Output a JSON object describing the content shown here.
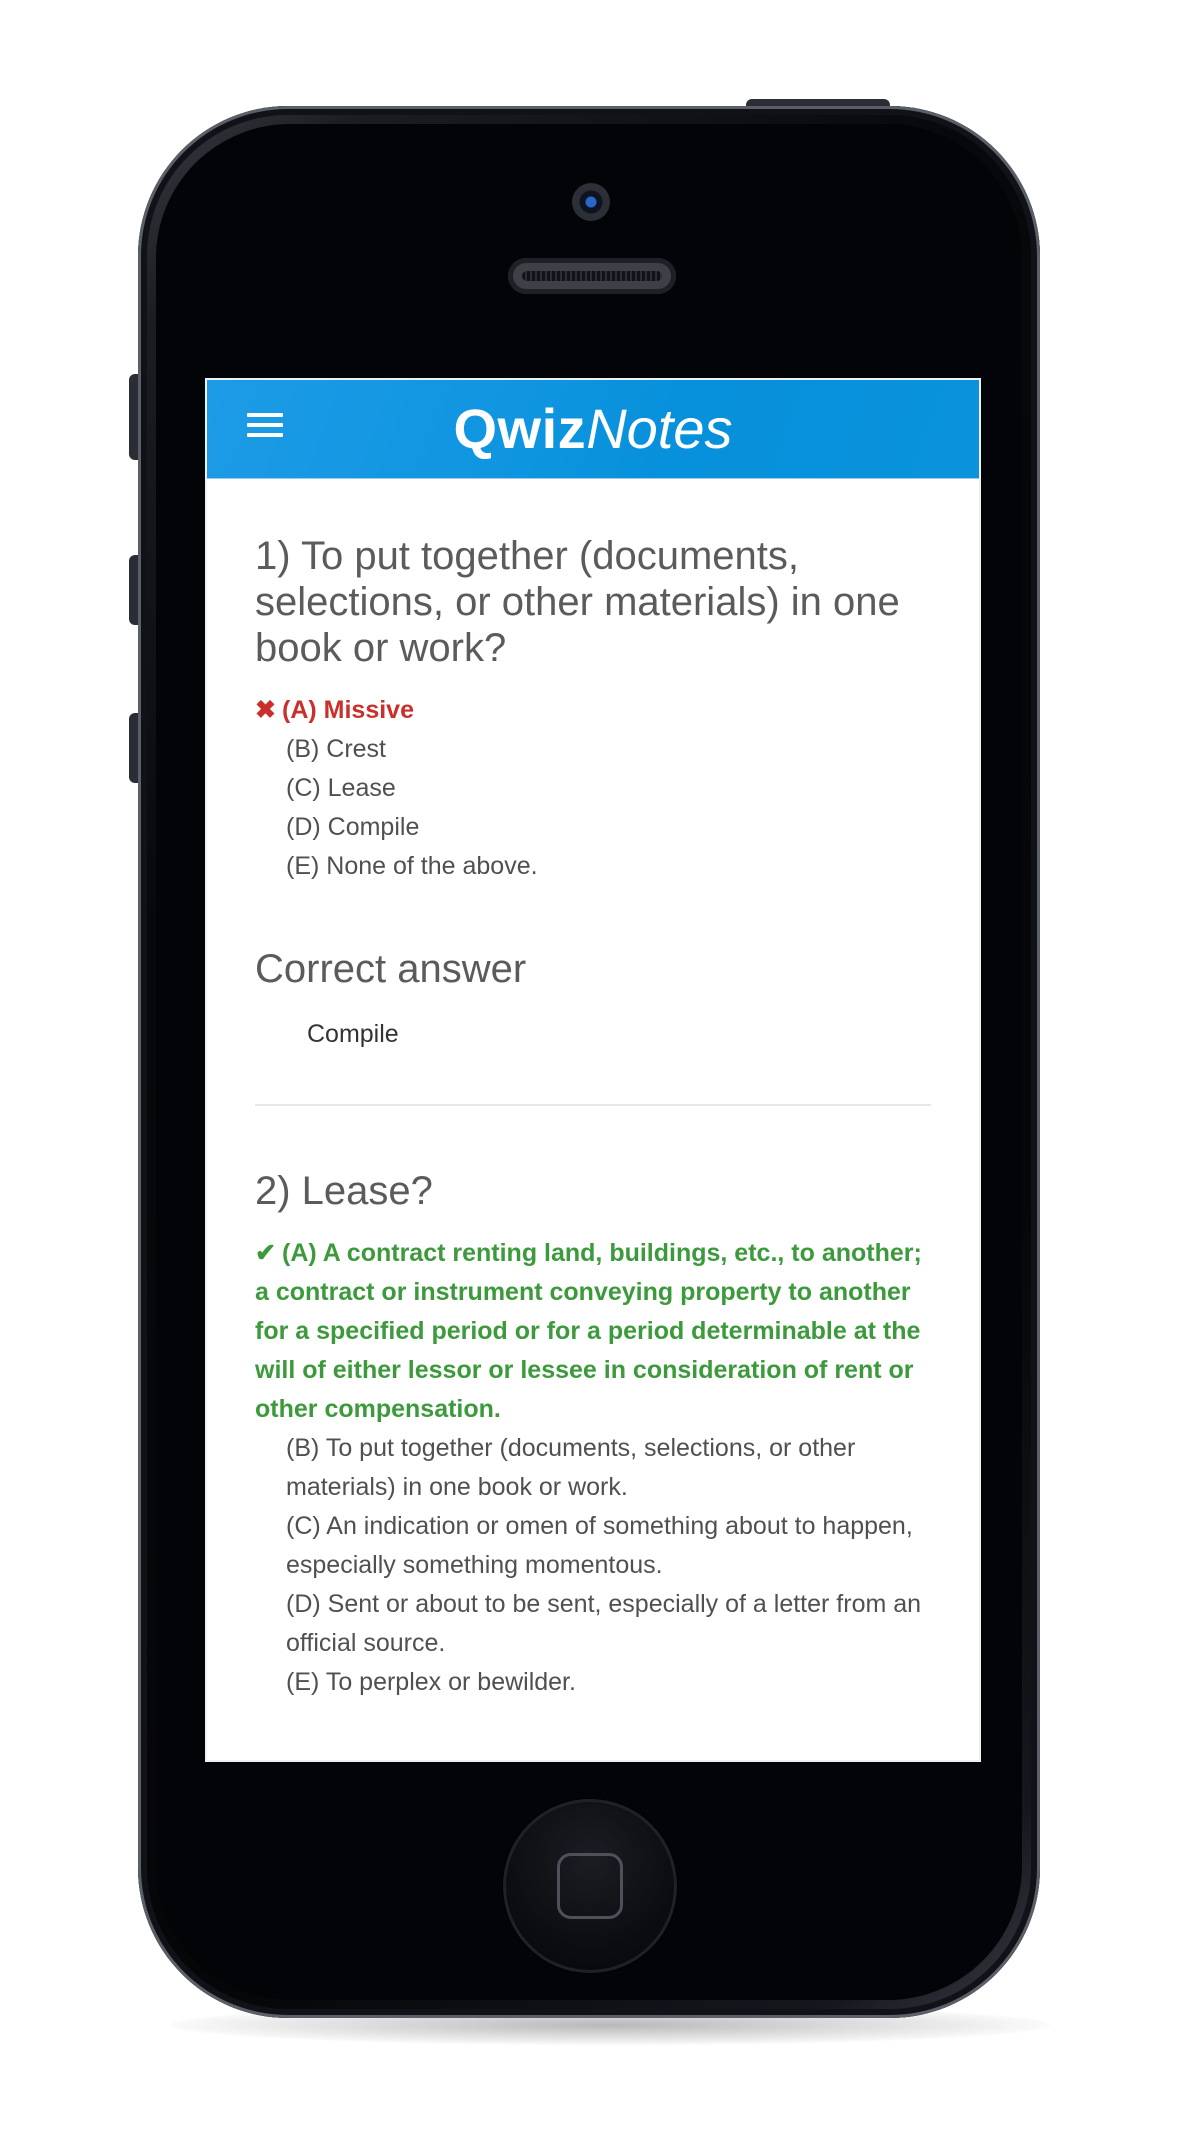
{
  "app": {
    "logo_strong": "Qwiz",
    "logo_light": "Notes"
  },
  "questions": [
    {
      "title": "1) To put together (documents, selections, or other materials) in one book or work?",
      "selected": {
        "mark": "✖",
        "text": "(A) Missive",
        "status": "wrong"
      },
      "options": [
        "(B) Crest",
        "(C) Lease",
        "(D) Compile",
        "(E) None of the above."
      ],
      "correct_heading": "Correct answer",
      "correct_value": "Compile"
    },
    {
      "title": "2) Lease?",
      "selected": {
        "mark": "✔",
        "text": "(A) A contract renting land, buildings, etc., to another; a contract or instrument conveying property to another for a specified period or for a period determinable at the will of either lessor or lessee in consideration of rent or other compensation.",
        "status": "correct"
      },
      "options": [
        "(B) To put together (documents, selections, or other materials) in one book or work.",
        "(C) An indication or omen of something about to happen, especially something momentous.",
        "(D) Sent or about to be sent, especially of a letter from an official source.",
        "(E) To perplex or bewilder."
      ]
    }
  ],
  "colors": {
    "header_blue": "#0f95e0",
    "wrong_red": "#c9302c",
    "correct_green": "#3c9a3c"
  },
  "icons": {
    "menu": "hamburger-menu-icon",
    "wrong": "cross-icon",
    "right": "check-icon"
  }
}
